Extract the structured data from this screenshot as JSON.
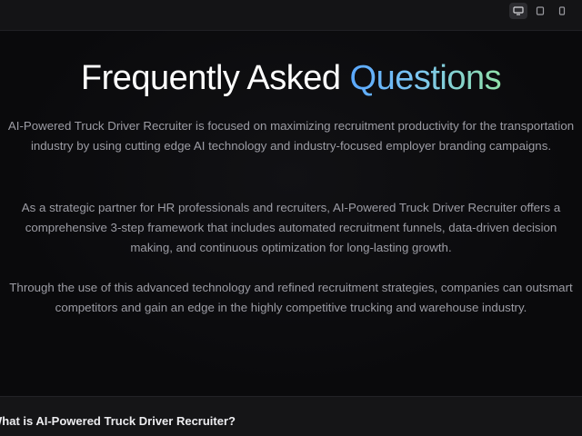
{
  "header": {
    "view_modes": [
      {
        "icon": "desktop-icon",
        "active": true
      },
      {
        "icon": "tablet-icon",
        "active": false
      },
      {
        "icon": "mobile-icon",
        "active": false
      }
    ]
  },
  "faq": {
    "title_main": "Frequently Asked ",
    "title_accent": "Questions",
    "accent_gradient": [
      "#5aa8ff",
      "#7cc6f0",
      "#8fe0a8"
    ],
    "paragraphs": [
      "AI-Powered Truck Driver Recruiter is focused on maximizing recruitment productivity for the transportation industry by using cutting edge AI technology and industry-focused employer branding campaigns.",
      "As a strategic partner for HR professionals and recruiters, AI-Powered Truck Driver Recruiter offers a comprehensive 3-step framework that includes automated recruitment funnels, data-driven decision making, and continuous optimization for long-lasting growth.",
      "Through the use of this advanced technology and refined recruitment strategies, companies can outsmart competitors and gain an edge in the highly competitive trucking and warehouse industry."
    ],
    "questions": [
      {
        "label": "What is AI-Powered Truck Driver Recruiter?"
      }
    ]
  }
}
